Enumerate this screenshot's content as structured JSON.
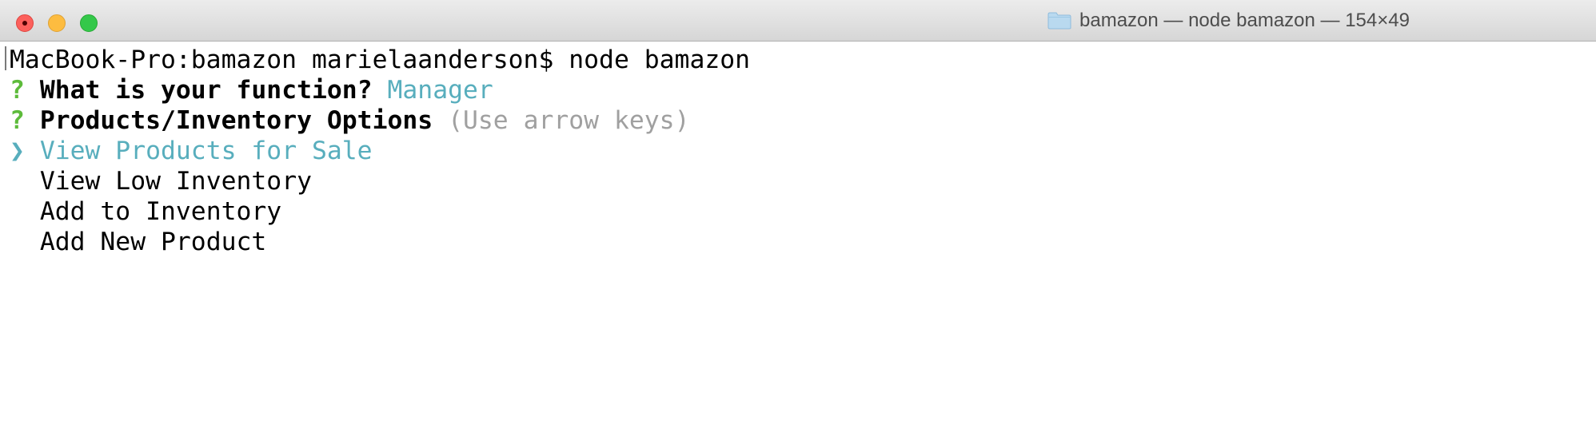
{
  "window": {
    "title": "bamazon — node bamazon — 154×49",
    "icon": "folder-icon",
    "controls": [
      "close",
      "minimize",
      "zoom"
    ]
  },
  "terminal": {
    "prompt": "MacBook-Pro:bamazon marielaanderson$ node bamazon",
    "question1": {
      "marker": "?",
      "text": "What is your function?",
      "answer": "Manager"
    },
    "question2": {
      "marker": "?",
      "text": "Products/Inventory Options",
      "hint": "(Use arrow keys)"
    },
    "options": {
      "pointer": "❯",
      "selected": "View Products for Sale",
      "items": [
        "View Low Inventory",
        "Add to Inventory",
        "Add New Product"
      ]
    }
  },
  "colors": {
    "accent": "#58aebd",
    "question_marker": "#5dbb3b",
    "hint": "#a0a0a0"
  }
}
